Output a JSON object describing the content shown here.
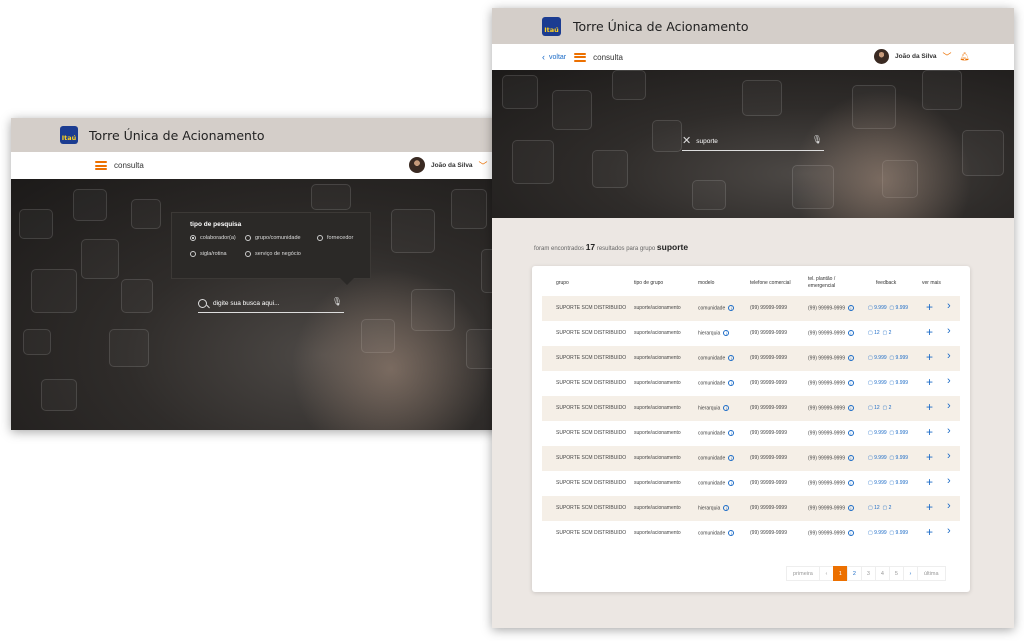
{
  "brand": {
    "logo_text": "Itaú",
    "app_title": "Torre Única de Acionamento",
    "accent": "#ec7000",
    "link_color": "#1b6bc7",
    "logo_color": "#1b3c91"
  },
  "user": {
    "name": "João da Silva"
  },
  "window1": {
    "nav_label": "consulta",
    "popup": {
      "title": "tipo de pesquisa",
      "options": [
        "colaborador(a)",
        "grupo/comunidade",
        "fornecedor",
        "sigla/rotina",
        "serviço de negócio"
      ],
      "selected": "colaborador(a)"
    },
    "search": {
      "placeholder": "digite sua busca aqui..."
    }
  },
  "window2": {
    "back_label": "voltar",
    "nav_label": "consulta",
    "search": {
      "value": "suporte"
    },
    "summary": {
      "prefix": "foram encontrados",
      "count": "17",
      "middle": "resultados para",
      "type": "grupo",
      "term": "suporte"
    },
    "table": {
      "headers": [
        "grupo",
        "tipo de grupo",
        "modelo",
        "telefone comercial",
        "tel. plantão / emergencial",
        "feedback",
        "ver mais"
      ],
      "rows": [
        {
          "grupo": "SUPORTE SCM DISTRIBUIDO",
          "tipo": "suporte/acionamento",
          "modelo": "comunidade",
          "tel": "(99) 99999-9999",
          "plantao": "(99) 99999-9999",
          "fb1": "9.999",
          "fb2": "9.999"
        },
        {
          "grupo": "SUPORTE SCM DISTRIBUIDO",
          "tipo": "suporte/acionamento",
          "modelo": "hierarquia",
          "tel": "(99) 99999-9999",
          "plantao": "(99) 99999-9999",
          "fb1": "12",
          "fb2": "2"
        },
        {
          "grupo": "SUPORTE SCM DISTRIBUIDO",
          "tipo": "suporte/acionamento",
          "modelo": "comunidade",
          "tel": "(99) 99999-9999",
          "plantao": "(99) 99999-9999",
          "fb1": "9.999",
          "fb2": "9.999"
        },
        {
          "grupo": "SUPORTE SCM DISTRIBUIDO",
          "tipo": "suporte/acionamento",
          "modelo": "comunidade",
          "tel": "(99) 99999-9999",
          "plantao": "(99) 99999-9999",
          "fb1": "9.999",
          "fb2": "9.999"
        },
        {
          "grupo": "SUPORTE SCM DISTRIBUIDO",
          "tipo": "suporte/acionamento",
          "modelo": "hierarquia",
          "tel": "(99) 99999-9999",
          "plantao": "(99) 99999-9999",
          "fb1": "12",
          "fb2": "2"
        },
        {
          "grupo": "SUPORTE SCM DISTRIBUIDO",
          "tipo": "suporte/acionamento",
          "modelo": "comunidade",
          "tel": "(99) 99999-9999",
          "plantao": "(99) 99999-9999",
          "fb1": "9.999",
          "fb2": "9.999"
        },
        {
          "grupo": "SUPORTE SCM DISTRIBUIDO",
          "tipo": "suporte/acionamento",
          "modelo": "comunidade",
          "tel": "(99) 99999-9999",
          "plantao": "(99) 99999-9999",
          "fb1": "9.999",
          "fb2": "9.999"
        },
        {
          "grupo": "SUPORTE SCM DISTRIBUIDO",
          "tipo": "suporte/acionamento",
          "modelo": "comunidade",
          "tel": "(99) 99999-9999",
          "plantao": "(99) 99999-9999",
          "fb1": "9.999",
          "fb2": "9.999"
        },
        {
          "grupo": "SUPORTE SCM DISTRIBUIDO",
          "tipo": "suporte/acionamento",
          "modelo": "hierarquia",
          "tel": "(99) 99999-9999",
          "plantao": "(99) 99999-9999",
          "fb1": "12",
          "fb2": "2"
        },
        {
          "grupo": "SUPORTE SCM DISTRIBUIDO",
          "tipo": "suporte/acionamento",
          "modelo": "comunidade",
          "tel": "(99) 99999-9999",
          "plantao": "(99) 99999-9999",
          "fb1": "9.999",
          "fb2": "9.999"
        }
      ]
    },
    "pagination": {
      "first": "primeira",
      "pages": [
        "1",
        "2",
        "3",
        "4",
        "5"
      ],
      "current": "1",
      "last": "última"
    }
  }
}
